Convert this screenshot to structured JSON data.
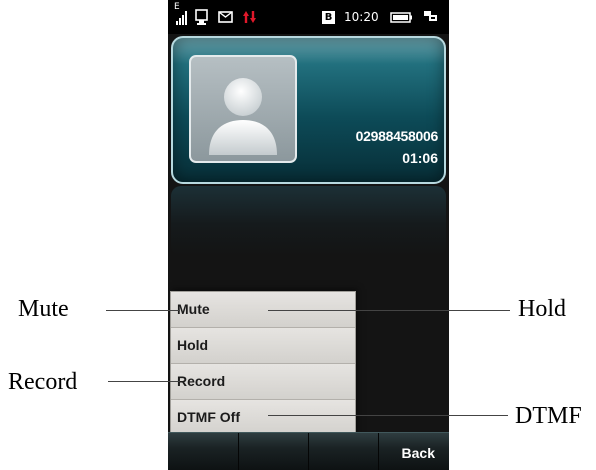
{
  "status_bar": {
    "network_badge": "E",
    "sim_badge": "B",
    "time": "10:20",
    "icons": [
      "signal-icon",
      "usb-connection-icon",
      "message-icon",
      "data-transfer-icon",
      "sim-icon",
      "battery-icon",
      "profile-icon"
    ],
    "transfer_color": "#e0182a"
  },
  "call": {
    "number": "02988458006",
    "duration": "01:06",
    "avatar_icon": "contact-placeholder-icon",
    "card_color": "#0d4b58"
  },
  "menu": {
    "items": [
      {
        "label": "Mute"
      },
      {
        "label": "Hold"
      },
      {
        "label": "Record"
      },
      {
        "label": "DTMF Off"
      }
    ]
  },
  "softkeys": {
    "right": "Back"
  },
  "callouts": {
    "mute": "Mute",
    "hold": "Hold",
    "record": "Record",
    "dtmf": "DTMF"
  }
}
